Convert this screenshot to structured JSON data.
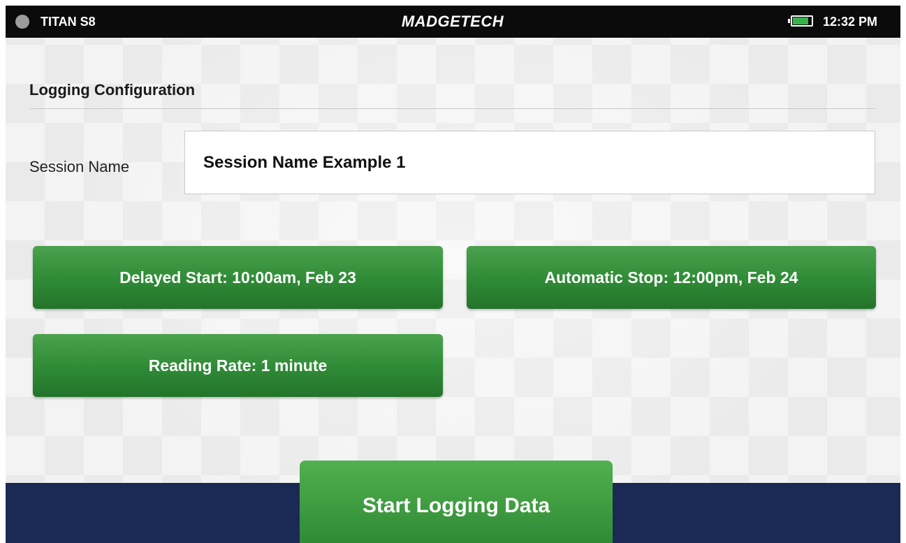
{
  "statusbar": {
    "device_name": "TITAN S8",
    "brand": "MADGETECH",
    "time": "12:32 PM",
    "battery_level": 0.85,
    "battery_color": "#35b34a"
  },
  "page": {
    "title": "Logging Configuration"
  },
  "session": {
    "label": "Session Name",
    "value": "Session Name Example 1"
  },
  "settings": {
    "delayed_start": "Delayed Start: 10:00am, Feb 23",
    "automatic_stop": "Automatic Stop: 12:00pm, Feb 24",
    "reading_rate": "Reading Rate: 1 minute"
  },
  "footer": {
    "start_label": "Start Logging Data"
  },
  "colors": {
    "accent_green": "#2f8a36",
    "footer_navy": "#1b2a54",
    "statusbar_black": "#0b0b0b"
  }
}
